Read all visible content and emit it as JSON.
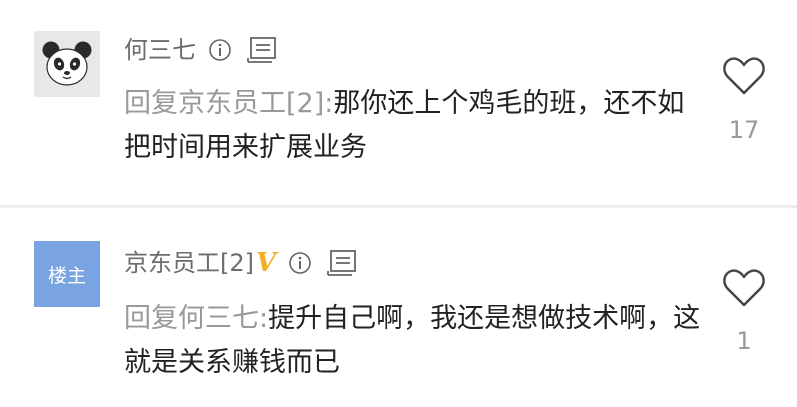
{
  "comments": [
    {
      "username": "何三七",
      "avatar": "panda-avatar",
      "reply_prefix": "回复京东员工[2]:",
      "text": "那你还上个鸡毛的班，还不如把时间用来扩展业务",
      "likes": "17"
    },
    {
      "username": "京东员工[2]",
      "verified_badge": "V",
      "avatar_label": "楼主",
      "reply_prefix": "回复何三七:",
      "text": "提升自己啊，我还是想做技术啊，这就是关系赚钱而已",
      "likes": "1"
    }
  ],
  "icons": {
    "info": "info-icon",
    "report": "report-icon",
    "like": "heart-outline-icon"
  },
  "colors": {
    "username": "#6c6c6c",
    "reply_prefix": "#999999",
    "body_text": "#222222",
    "verified_badge": "#f0b020",
    "op_avatar_bg": "#7aa3e2",
    "divider": "#eeeeee"
  }
}
